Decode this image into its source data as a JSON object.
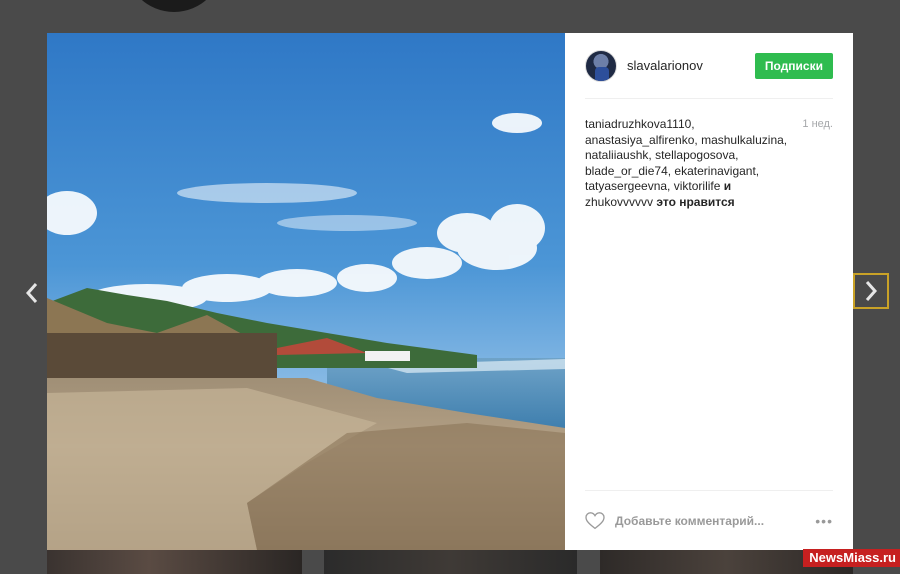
{
  "post": {
    "username": "slavalarionov",
    "follow_label": "Подписки",
    "time_ago": "1 нед.",
    "likers": [
      "taniadruzhkova1110,",
      "anastasiya_alfirenko,",
      "mashulkaluzina,",
      "nataliiaushk,",
      "stellapogosova,",
      "blade_or_die74,",
      "ekaterinavigant,",
      "tatyasergeevna,",
      "viktorilife"
    ],
    "and_word": "и",
    "last_liker": "zhukovvvvvv",
    "likes_suffix": "это нравится",
    "comment_placeholder": "Добавьте комментарий...",
    "more_label": "•••"
  },
  "watermark": "NewsMiass.ru",
  "icons": {
    "prev": "chevron-left-icon",
    "next": "chevron-right-icon",
    "like": "heart-icon"
  },
  "colors": {
    "follow_button": "#2fbc4f",
    "watermark_bg": "#c62020",
    "next_border": "#c9a227"
  }
}
